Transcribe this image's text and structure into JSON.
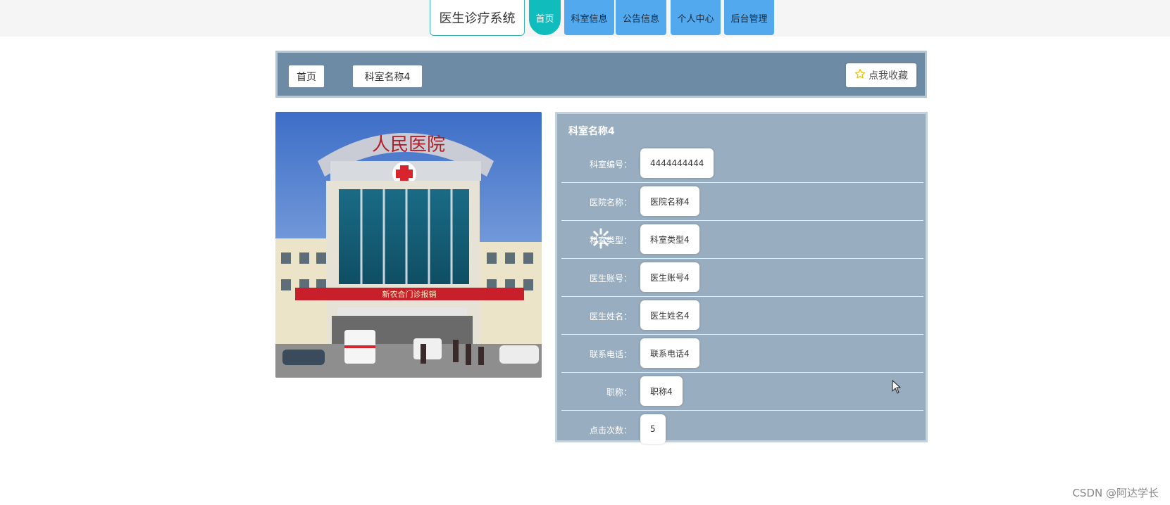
{
  "nav": {
    "brand": "医生诊疗系统",
    "items": [
      {
        "label": "首页",
        "active": true
      },
      {
        "label": "科室信息",
        "active": false
      },
      {
        "label": "公告信息",
        "active": false
      },
      {
        "label": "个人中心",
        "active": false
      },
      {
        "label": "后台管理",
        "active": false
      }
    ]
  },
  "breadcrumb": {
    "home": "首页",
    "current": "科室名称4",
    "favorite_label": "点我收藏"
  },
  "detail": {
    "title": "科室名称4",
    "fields": [
      {
        "label": "科室编号：",
        "value": "4444444444"
      },
      {
        "label": "医院名称：",
        "value": "医院名称4"
      },
      {
        "label": "科室类型：",
        "value": "科室类型4"
      },
      {
        "label": "医生账号：",
        "value": "医生账号4"
      },
      {
        "label": "医生姓名：",
        "value": "医生姓名4"
      },
      {
        "label": "联系电话：",
        "value": "联系电话4"
      },
      {
        "label": "职称：",
        "value": "职称4"
      },
      {
        "label": "点击次数：",
        "value": "5"
      }
    ]
  },
  "photo": {
    "sign_text": "人民医院",
    "banner_text": "新农合门诊报销"
  },
  "watermark": "CSDN @阿达学长",
  "colors": {
    "nav_active": "#10bcbc",
    "nav_button": "#52a9ee",
    "breadcrumb_bar": "#6d8ba4",
    "detail_panel": "#98adbf",
    "star": "#e9c400"
  }
}
